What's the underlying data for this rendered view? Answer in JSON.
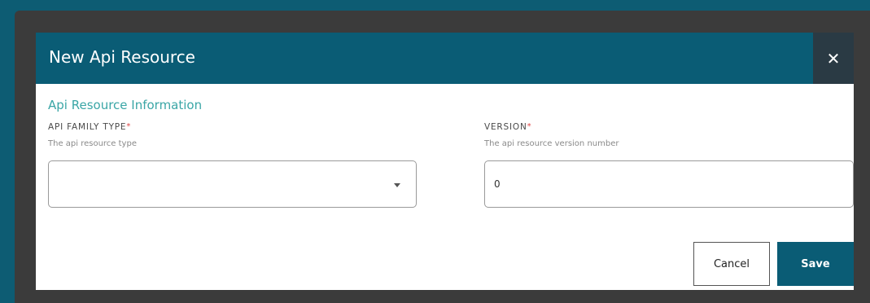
{
  "dialog": {
    "title": "New Api Resource",
    "close_icon": "close-icon",
    "close_label": "✕"
  },
  "section": {
    "title": "Api Resource Information"
  },
  "fields": {
    "family_type": {
      "label": "API FAMILY TYPE",
      "required_mark": "*",
      "help": "The api resource type",
      "value": ""
    },
    "version": {
      "label": "VERSION",
      "required_mark": "*",
      "help": "The api resource version number",
      "value": "0"
    }
  },
  "actions": {
    "cancel_label": "Cancel",
    "save_label": "Save"
  },
  "colors": {
    "header": "#0a5c75",
    "accent": "#3aa6a6",
    "required": "#e04545",
    "background": "#0d5c73"
  }
}
